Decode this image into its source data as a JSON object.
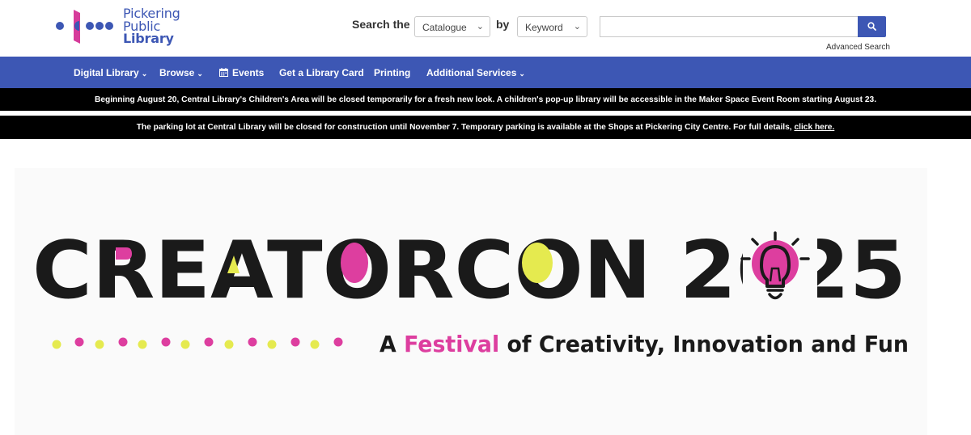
{
  "logo": {
    "line1": "Pickering",
    "line2": "Public",
    "line3": "Library",
    "colors": {
      "blue": "#3d57b4",
      "magenta": "#d63b9a"
    }
  },
  "search": {
    "label": "Search the",
    "scope_selected": "Catalogue",
    "by_label": "by",
    "type_selected": "Keyword",
    "query_value": "",
    "button_icon": "search-icon",
    "advanced_link": "Advanced Search"
  },
  "nav": {
    "items": [
      {
        "label": "Digital Library",
        "has_dropdown": true
      },
      {
        "label": "Browse",
        "has_dropdown": true
      },
      {
        "label": "Events",
        "icon": "calendar-icon"
      },
      {
        "label": "Get a Library Card"
      },
      {
        "label": "Printing"
      },
      {
        "label": "Additional Services",
        "has_dropdown": true
      }
    ],
    "background": "#3d57b4"
  },
  "alerts": {
    "alert1": "Beginning August 20, Central Library's Children's Area will be closed temporarily for a fresh new look. A children's pop-up library will be accessible in the Maker Space Event Room starting August 23.",
    "alert2_text": "The parking lot at Central Library will be closed for construction until November 7. Temporary parking is available at the Shops at Pickering City Centre. For full details,",
    "alert2_link": "click here."
  },
  "banner": {
    "title": "CREATORCON 2025",
    "tagline_a": "A",
    "tagline_highlight": "Festival",
    "tagline_rest": "of Creativity, Innovation and Fun",
    "colors": {
      "magenta": "#dd3e9f",
      "yellow": "#e5ea4f",
      "dark": "#1a1a1a"
    }
  }
}
